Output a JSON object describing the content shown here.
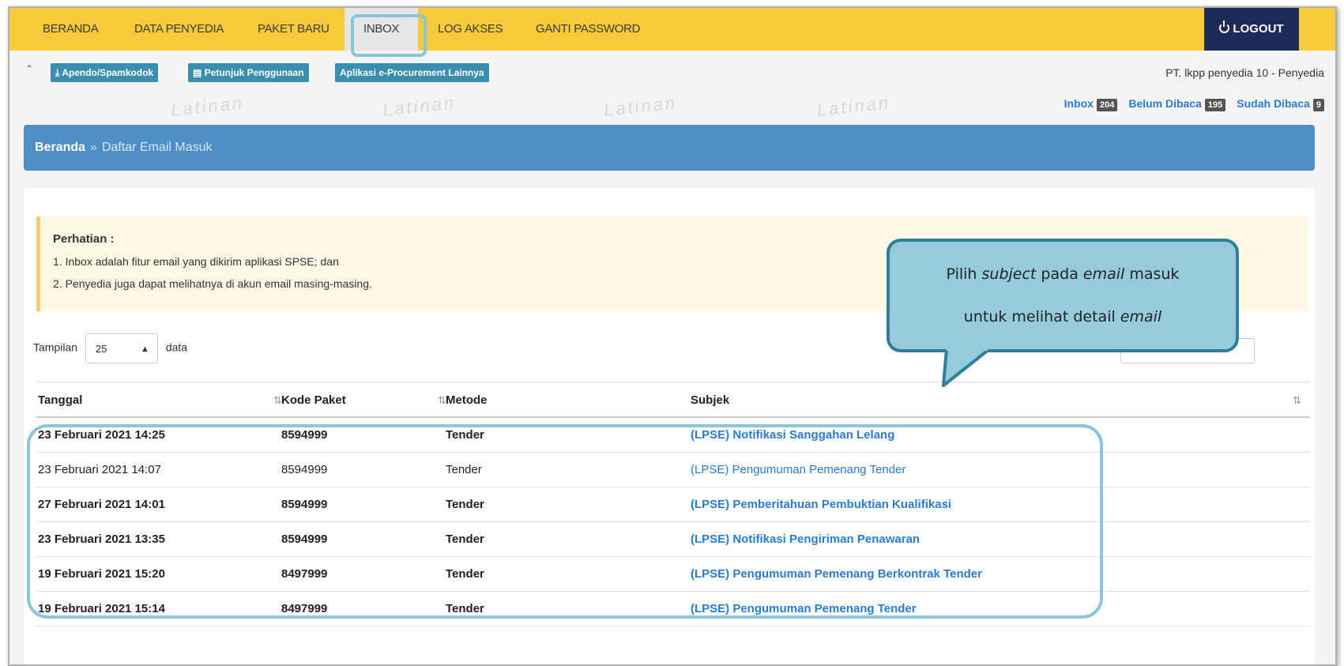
{
  "nav": {
    "items": [
      {
        "label": "BERANDA"
      },
      {
        "label": "DATA PENYEDIA"
      },
      {
        "label": "PAKET BARU"
      },
      {
        "label": "INBOX"
      },
      {
        "label": "LOG AKSES"
      },
      {
        "label": "GANTI PASSWORD"
      }
    ],
    "logout_label": "LOGOUT",
    "accent_color": "#f8ca3a"
  },
  "subbar": {
    "pills": [
      {
        "label": "⤓ Apendo/Spamkodok"
      },
      {
        "label": "▤ Petunjuk Penggunaan"
      },
      {
        "label": "Aplikasi e-Procurement Lainnya"
      }
    ],
    "company": "PT. lkpp penyedia 10 - Penyedia",
    "watermark": "Latinan"
  },
  "counters": {
    "inbox_label": "Inbox",
    "inbox_count": "204",
    "unread_label": "Belum Dibaca",
    "unread_count": "195",
    "read_label": "Sudah Dibaca",
    "read_count": "9"
  },
  "breadcrumb": {
    "home": "Beranda",
    "separator": "»",
    "current": "Daftar Email Masuk"
  },
  "notice": {
    "title": "Perhatian :",
    "lines": [
      "1. Inbox adalah fitur email yang dikirim aplikasi SPSE; dan",
      "2. Penyedia juga dapat melihatnya di akun email masing-masing."
    ]
  },
  "length_control": {
    "prefix": "Tampilan",
    "value": "25",
    "suffix": "data"
  },
  "table": {
    "columns": [
      "Tanggal",
      "Kode Paket",
      "Metode",
      "Subjek"
    ],
    "rows": [
      {
        "date": "23 Februari 2021 14:25",
        "code": "8594999",
        "method": "Tender",
        "subject": "(LPSE) Notifikasi Sanggahan Lelang",
        "unread": true
      },
      {
        "date": "23 Februari 2021 14:07",
        "code": "8594999",
        "method": "Tender",
        "subject": "(LPSE) Pengumuman Pemenang Tender",
        "unread": false
      },
      {
        "date": "27 Februari 2021 14:01",
        "code": "8594999",
        "method": "Tender",
        "subject": "(LPSE) Pemberitahuan Pembuktian Kualifikasi",
        "unread": true
      },
      {
        "date": "23 Februari 2021 13:35",
        "code": "8594999",
        "method": "Tender",
        "subject": "(LPSE) Notifikasi Pengiriman Penawaran",
        "unread": true
      },
      {
        "date": "19 Februari 2021 15:20",
        "code": "8497999",
        "method": "Tender",
        "subject": "(LPSE) Pengumuman Pemenang Berkontrak Tender",
        "unread": true
      },
      {
        "date": "19 Februari 2021 15:14",
        "code": "8497999",
        "method": "Tender",
        "subject": "(LPSE) Pengumuman Pemenang Tender",
        "unread": true
      }
    ]
  },
  "callout": {
    "line1_pre": "Pilih ",
    "line1_em1": "subject",
    "line1_mid": " pada ",
    "line1_em2": "email",
    "line1_post": " masuk",
    "line2_pre": "untuk melihat detail ",
    "line2_em": "email"
  }
}
